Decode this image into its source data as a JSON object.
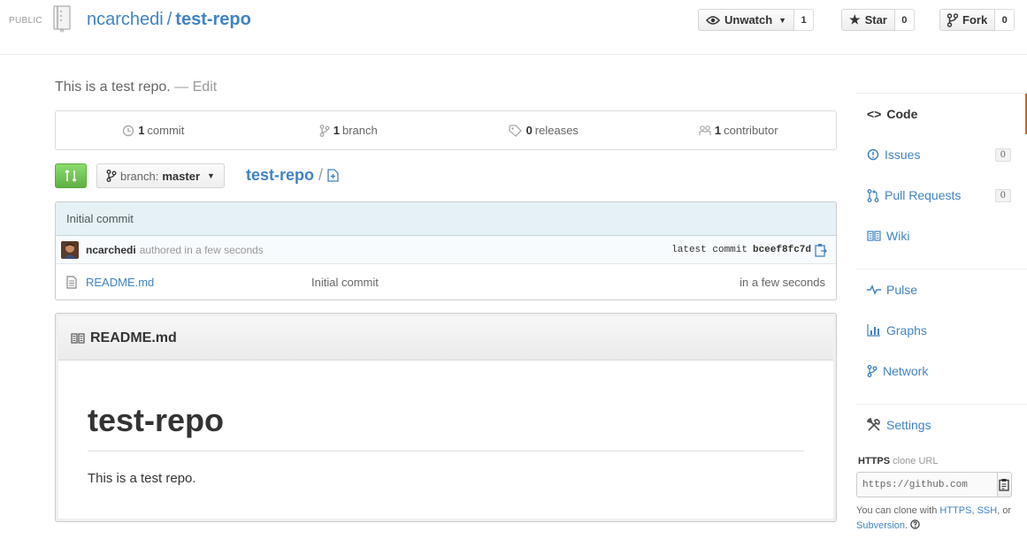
{
  "header": {
    "visibility": "PUBLIC",
    "owner": "ncarchedi",
    "separator": "/",
    "repo": "test-repo",
    "watch": {
      "label": "Unwatch",
      "count": "1"
    },
    "star": {
      "label": "Star",
      "count": "0"
    },
    "fork": {
      "label": "Fork",
      "count": "0"
    }
  },
  "description": {
    "text": "This is a test repo.",
    "edit": "— Edit"
  },
  "summary": [
    {
      "icon": "history-icon",
      "count": "1",
      "label": "commit"
    },
    {
      "icon": "branch-icon",
      "count": "1",
      "label": "branch"
    },
    {
      "icon": "tag-icon",
      "count": "0",
      "label": "releases"
    },
    {
      "icon": "organization-icon",
      "count": "1",
      "label": "contributor"
    }
  ],
  "filenav": {
    "branch_prefix": "branch:",
    "branch": "master",
    "root": "test-repo",
    "slash": "/"
  },
  "commit": {
    "title": "Initial commit",
    "author": "ncarchedi",
    "when": "authored in a few seconds",
    "latest_label": "latest commit",
    "sha": "bceef8fc7d"
  },
  "files": [
    {
      "name": "README.md",
      "message": "Initial commit",
      "age": "in a few seconds"
    }
  ],
  "readme": {
    "header": "README.md",
    "heading": "test-repo",
    "body": "This is a test repo."
  },
  "sidebar": {
    "groups": [
      [
        {
          "label": "Code",
          "icon": "code-icon",
          "selected": true
        },
        {
          "label": "Issues",
          "icon": "issue-icon",
          "badge": "0"
        },
        {
          "label": "Pull Requests",
          "icon": "pull-request-icon",
          "badge": "0"
        },
        {
          "label": "Wiki",
          "icon": "book-icon"
        }
      ],
      [
        {
          "label": "Pulse",
          "icon": "pulse-icon"
        },
        {
          "label": "Graphs",
          "icon": "graph-icon"
        },
        {
          "label": "Network",
          "icon": "network-icon"
        }
      ],
      [
        {
          "label": "Settings",
          "icon": "tools-icon"
        }
      ]
    ],
    "clone": {
      "protocol": "HTTPS",
      "label": "clone URL",
      "url": "https://github.com",
      "help_prefix": "You can clone with",
      "https": "HTTPS",
      "comma": ",",
      "ssh": "SSH",
      "or": ", or",
      "subversion": "Subversion",
      "period": "."
    }
  },
  "colors": {
    "accent": "#4183c4",
    "selected_bar": "#d26911",
    "compare_green": "#60b044"
  }
}
